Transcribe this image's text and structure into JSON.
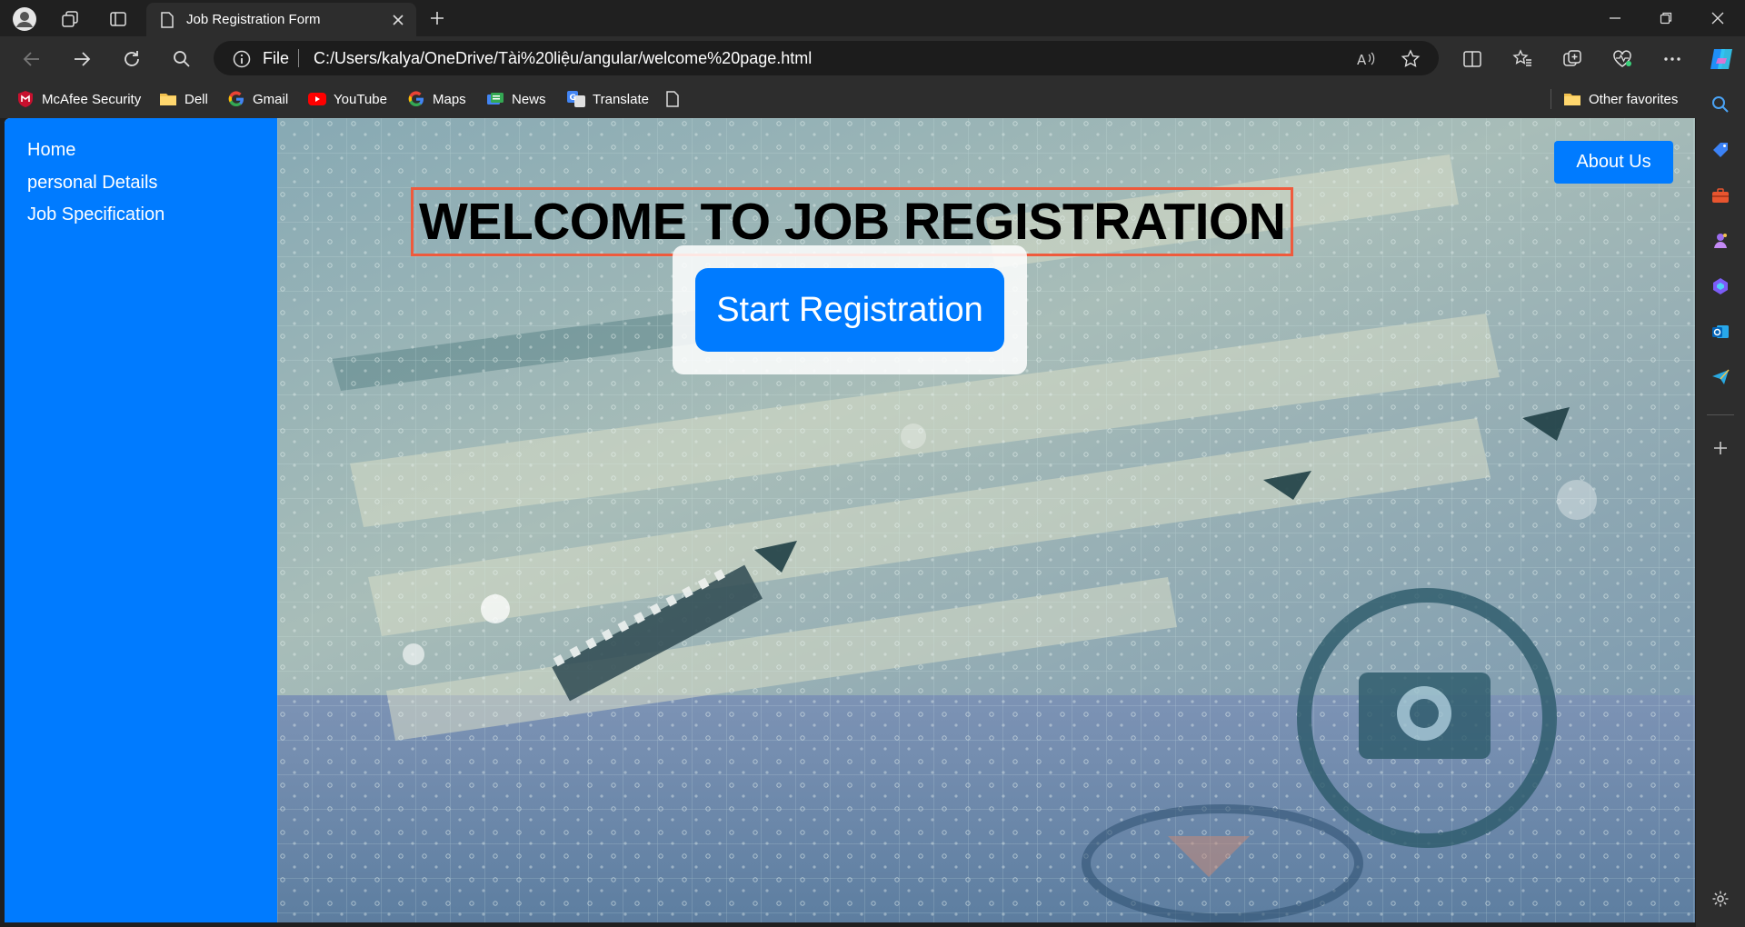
{
  "browser": {
    "tab_title": "Job Registration Form",
    "address_prefix": "File",
    "url": "C:/Users/kalya/OneDrive/Tài%20liệu/angular/welcome%20page.html",
    "favorites": [
      {
        "label": "McAfee Security",
        "icon": "mcafee-icon"
      },
      {
        "label": "Dell",
        "icon": "folder-icon"
      },
      {
        "label": "Gmail",
        "icon": "google-icon"
      },
      {
        "label": "YouTube",
        "icon": "youtube-icon"
      },
      {
        "label": "Maps",
        "icon": "google-icon"
      },
      {
        "label": "News",
        "icon": "news-icon"
      },
      {
        "label": "Translate",
        "icon": "translate-icon"
      }
    ],
    "other_favorites": "Other favorites"
  },
  "sidebar": {
    "links": [
      {
        "label": "Home"
      },
      {
        "label": "personal Details"
      },
      {
        "label": "Job Specification"
      }
    ]
  },
  "hero": {
    "heading": "WELCOME TO JOB REGISTRATION",
    "start_button": "Start Registration",
    "about_button": "About Us"
  },
  "colors": {
    "primary": "#007bff",
    "heading_border": "#ef5a3c",
    "chrome_dark": "#202020",
    "chrome_toolbar": "#2d2d2d"
  }
}
